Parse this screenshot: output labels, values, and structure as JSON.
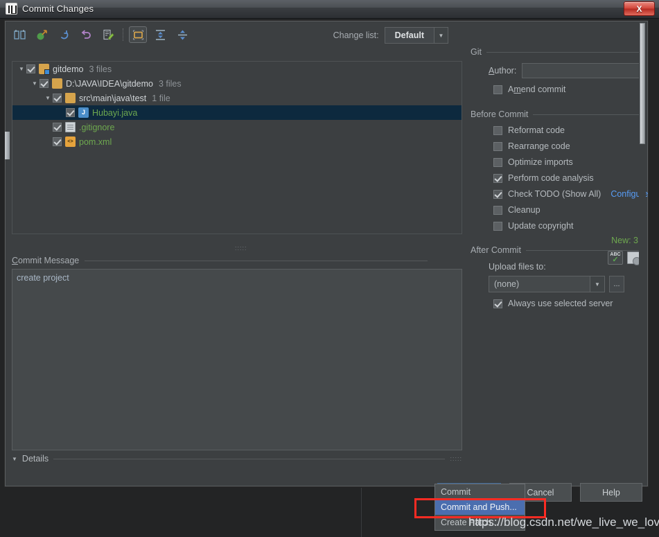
{
  "window": {
    "title": "Commit Changes",
    "app_icon": "intellij-idea-icon",
    "close_label": "X"
  },
  "toolbar": {
    "buttons": [
      {
        "name": "show-diff-icon",
        "glyph": "diff"
      },
      {
        "name": "revert-group-icon",
        "glyph": "group"
      },
      {
        "name": "refresh-icon",
        "glyph": "refresh"
      },
      {
        "name": "rollback-icon",
        "glyph": "rollback"
      },
      {
        "name": "edit-source-icon",
        "glyph": "edit"
      },
      {
        "name": "group-by-directory-icon",
        "glyph": "folder",
        "active": true
      },
      {
        "name": "expand-all-icon",
        "glyph": "expand"
      },
      {
        "name": "collapse-all-icon",
        "glyph": "collapse"
      }
    ],
    "change_list_label": "Change list:",
    "change_list_value": "Default"
  },
  "tree": {
    "rows": [
      {
        "indent": 0,
        "twisty": "▼",
        "checked": true,
        "icon": "folder-module-icon",
        "name": "gitdemo",
        "count": "3 files",
        "green": false,
        "selected": false
      },
      {
        "indent": 1,
        "twisty": "▼",
        "checked": true,
        "icon": "folder-icon",
        "name": "D:\\JAVA\\IDEA\\gitdemo",
        "count": "3 files",
        "green": false,
        "selected": false
      },
      {
        "indent": 2,
        "twisty": "▼",
        "checked": true,
        "icon": "folder-icon",
        "name": "src\\main\\java\\test",
        "count": "1 file",
        "green": false,
        "selected": false
      },
      {
        "indent": 3,
        "twisty": "",
        "checked": true,
        "icon": "java-file-icon",
        "name": "Hubayi.java",
        "count": "",
        "green": true,
        "selected": true
      },
      {
        "indent": 2,
        "twisty": "",
        "checked": true,
        "icon": "text-file-icon",
        "name": ".gitignore",
        "count": "",
        "green": true,
        "selected": false
      },
      {
        "indent": 2,
        "twisty": "",
        "checked": true,
        "icon": "xml-file-icon",
        "name": "pom.xml",
        "count": "",
        "green": true,
        "selected": false
      }
    ],
    "new_count": "New: 3"
  },
  "commit_message": {
    "section_label": "Commit Message",
    "value": "create project",
    "spellcheck_icon_text": "ABC",
    "spellcheck_icon_check": "✓",
    "history_icon": "message-history-icon"
  },
  "details": {
    "label": "Details",
    "caret": "▼"
  },
  "git_section": {
    "label": "Git",
    "author_label": "Author:",
    "author_value": "",
    "amend_label": "Amend commit",
    "amend_checked": false
  },
  "before_commit": {
    "label": "Before Commit",
    "items": [
      {
        "label": "Reformat code",
        "checked": false,
        "link": ""
      },
      {
        "label": "Rearrange code",
        "checked": false,
        "link": ""
      },
      {
        "label": "Optimize imports",
        "checked": false,
        "link": ""
      },
      {
        "label": "Perform code analysis",
        "checked": true,
        "link": ""
      },
      {
        "label": "Check TODO (Show All)",
        "checked": true,
        "link": "Configure"
      },
      {
        "label": "Cleanup",
        "checked": false,
        "link": ""
      },
      {
        "label": "Update copyright",
        "checked": false,
        "link": ""
      }
    ]
  },
  "after_commit": {
    "label": "After Commit",
    "upload_label": "Upload files to:",
    "upload_value": "(none)",
    "browse_label": "...",
    "always_label": "Always use selected server",
    "always_checked": true
  },
  "footer": {
    "commit_label": "Commit",
    "commit_caret": "▾",
    "cancel_label": "Cancel",
    "help_label": "Help"
  },
  "dropdown": {
    "items": [
      {
        "label": "Commit",
        "selected": false
      },
      {
        "label": "Commit and Push...",
        "selected": true
      },
      {
        "label": "Create Patch...",
        "selected": false
      }
    ]
  },
  "watermark": {
    "text": "https://blog.csdn.net/we_live_we_love"
  },
  "colors": {
    "dialog_bg": "#3c3f41",
    "accent_blue": "#4b6eaf",
    "primary_button": "#2f4f73",
    "link_blue": "#589df6",
    "green_file": "#6ea84f",
    "highlight_red": "#fc2b23",
    "selection_row": "#0d293e"
  }
}
